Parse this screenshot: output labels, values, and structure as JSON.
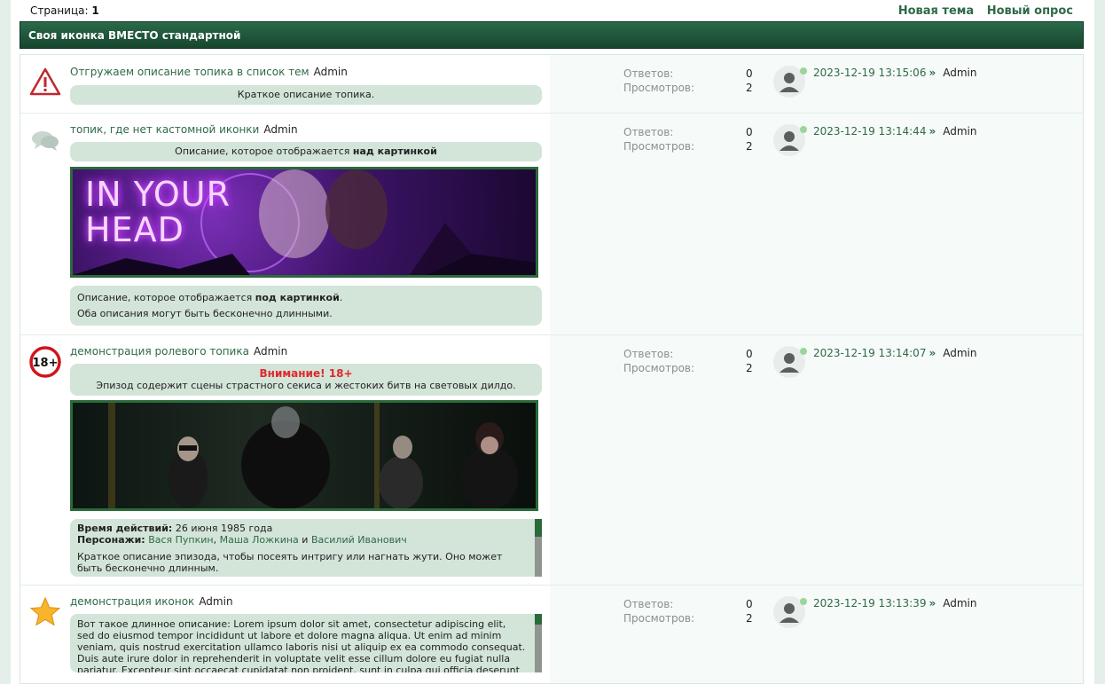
{
  "pager": {
    "label": "Страница:",
    "current": "1"
  },
  "actions": {
    "new_topic": "Новая тема",
    "new_poll": "Новый опрос"
  },
  "category": {
    "title": "Своя иконка ВМЕСТО стандартной"
  },
  "stats_labels": {
    "replies": "Ответов:",
    "views": "Просмотров:"
  },
  "topics": [
    {
      "icon": "warning-triangle-icon",
      "title": "Отгружаем описание топика в список тем",
      "author": "Admin",
      "desc": "Краткое описание топика.",
      "replies": "0",
      "views": "2",
      "last_date": "2023-12-19 13:15:06",
      "last_arrow": "»",
      "last_author": "Admin"
    },
    {
      "icon": "speech-bubbles-icon",
      "title": "топик, где нет кастомной иконки",
      "author": "Admin",
      "desc_above_prefix": "Описание, которое отображается ",
      "desc_above_bold": "над картинкой",
      "banner_text": "IN YOUR HEAD",
      "desc_below_prefix": "Описание, которое отображается ",
      "desc_below_bold": "под картинкой",
      "desc_below_suffix": ".",
      "desc_below_line2": "Оба описания могут быть бесконечно длинными.",
      "replies": "0",
      "views": "2",
      "last_date": "2023-12-19 13:14:44",
      "last_arrow": "»",
      "last_author": "Admin"
    },
    {
      "icon": "age-18-plus-icon",
      "icon_text": "18+",
      "title": "демонстрация ролевого топика",
      "author": "Admin",
      "warning_title": "Внимание! 18+",
      "warning_text": "Эпизод содержит сцены страстного секиса и жестоких битв на световых дилдо.",
      "time_label": "Время действий:",
      "time_value": "26 июня 1985 года",
      "chars_label": "Персонажи:",
      "char1": "Вася Пупкин",
      "char_sep": ",",
      "char2": "Маша Ложкина",
      "char_and": "и",
      "char3": "Василий Иванович",
      "episode_desc": "Краткое описание эпизода, чтобы посеять интригу или нагнать жути. Оно может быть бесконечно длинным.",
      "replies": "0",
      "views": "2",
      "last_date": "2023-12-19 13:14:07",
      "last_arrow": "»",
      "last_author": "Admin"
    },
    {
      "icon": "star-icon",
      "title": "демонстрация иконок",
      "author": "Admin",
      "long_desc": "Вот такое длинное описание: Lorem ipsum dolor sit amet, consectetur adipiscing elit, sed do eiusmod tempor incididunt ut labore et dolore magna aliqua. Ut enim ad minim veniam, quis nostrud exercitation ullamco laboris nisi ut aliquip ex ea commodo consequat. Duis aute irure dolor in reprehenderit in voluptate velit esse cillum dolore eu fugiat nulla pariatur. Excepteur sint occaecat cupidatat non proident, sunt in culpa qui officia deserunt mollit anim id est laborum.",
      "replies": "0",
      "views": "2",
      "last_date": "2023-12-19 13:13:39",
      "last_arrow": "»",
      "last_author": "Admin"
    }
  ]
}
